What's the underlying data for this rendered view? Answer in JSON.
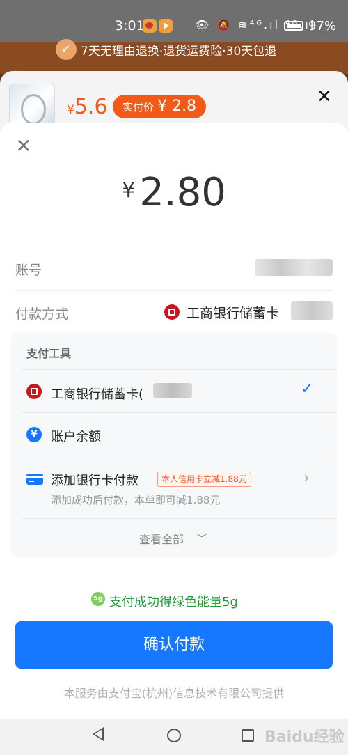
{
  "status_bar": {
    "time": "3:01",
    "icons_text": "👁 🔕 ≋⁴ᴳ.ıl ⁴ᴳ.ıl",
    "battery": "97%"
  },
  "background_page": {
    "promo": "7天无理由退换·退货运费险·30天包退"
  },
  "product": {
    "currency": "¥",
    "price": "5.6",
    "actual_label": "实付价",
    "actual_price": "¥ 2.8"
  },
  "payment": {
    "currency": "¥",
    "amount": "2.80",
    "account_label": "账号",
    "method_label": "付款方式",
    "method_value": "工商银行储蓄卡"
  },
  "tools": {
    "title": "支付工具",
    "items": [
      {
        "label": "工商银行储蓄卡(",
        "icon": "icbc-icon",
        "selected": true
      },
      {
        "label": "账户余额",
        "icon": "yuan-icon"
      },
      {
        "label": "添加银行卡付款",
        "icon": "card-icon",
        "tag": "本人信用卡立减1.88元",
        "sub": "添加成功后付款，本单即可减1.88元"
      }
    ],
    "view_all": "查看全部"
  },
  "energy": {
    "badge": "5g",
    "text": "支付成功得绿色能量5g"
  },
  "confirm_label": "确认付款",
  "footer": "本服务由支付宝(杭州)信息技术有限公司提供",
  "watermark": "Baidu经验",
  "colors": {
    "primary": "#1677ff",
    "accent": "#f25a1a",
    "green": "#1f9d3a"
  }
}
